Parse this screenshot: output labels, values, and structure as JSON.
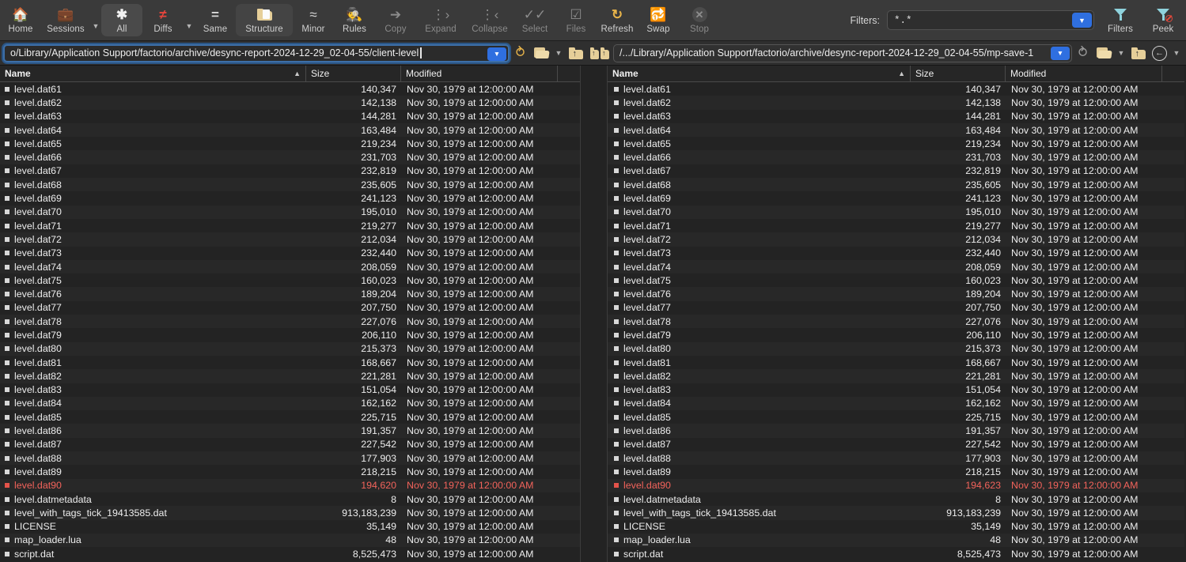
{
  "toolbar": {
    "buttons": [
      {
        "label": "Home",
        "icon": "home-icon",
        "state": "normal"
      },
      {
        "label": "Sessions",
        "icon": "briefcase-icon",
        "state": "normal",
        "caret": true
      },
      {
        "label": "All",
        "icon": "asterisk-icon",
        "state": "active"
      },
      {
        "label": "Diffs",
        "icon": "not-equal-icon",
        "state": "normal",
        "caret": true
      },
      {
        "label": "Same",
        "icon": "equals-icon",
        "state": "normal"
      },
      {
        "label": "Structure",
        "icon": "folder-file-icon",
        "state": "panel",
        "caret": true
      },
      {
        "label": "Minor",
        "icon": "approx-equal-icon",
        "state": "normal"
      },
      {
        "label": "Rules",
        "icon": "detective-icon",
        "state": "normal"
      },
      {
        "label": "Copy",
        "icon": "right-arrow-icon",
        "state": "disabled"
      },
      {
        "label": "Expand",
        "icon": "expand-tree-icon",
        "state": "disabled"
      },
      {
        "label": "Collapse",
        "icon": "collapse-tree-icon",
        "state": "disabled"
      },
      {
        "label": "Select",
        "icon": "double-check-icon",
        "state": "disabled"
      },
      {
        "label": "Files",
        "icon": "checked-file-icon",
        "state": "disabled"
      },
      {
        "label": "Refresh",
        "icon": "refresh-icon",
        "state": "normal"
      },
      {
        "label": "Swap",
        "icon": "swap-icon",
        "state": "normal"
      },
      {
        "label": "Stop",
        "icon": "stop-x-icon",
        "state": "disabled"
      }
    ],
    "filters_label": "Filters:",
    "filters_value": "*.*",
    "filters_button_label": "Filters",
    "peek_button_label": "Peek"
  },
  "pathbar": {
    "left_path": "o/Library/Application Support/factorio/archive/desync-report-2024-12-29_02-04-55/client-level",
    "right_path": "/.../Library/Application Support/factorio/archive/desync-report-2024-12-29_02-04-55/mp-save-1"
  },
  "columns": {
    "name": "Name",
    "size": "Size",
    "modified": "Modified"
  },
  "timestamp": "Nov 30, 1979 at 12:00:00 AM",
  "colors": {
    "diff_red": "#f2635b",
    "accent_blue": "#2f6fe0",
    "folder_yellow": "#e6cf99",
    "refresh_orange": "#e8b44a"
  },
  "left_pane": {
    "rows": [
      {
        "name": "level.dat61",
        "size": "140,347",
        "modified": "Nov 30, 1979 at 12:00:00 AM",
        "diff": false
      },
      {
        "name": "level.dat62",
        "size": "142,138",
        "modified": "Nov 30, 1979 at 12:00:00 AM",
        "diff": false
      },
      {
        "name": "level.dat63",
        "size": "144,281",
        "modified": "Nov 30, 1979 at 12:00:00 AM",
        "diff": false
      },
      {
        "name": "level.dat64",
        "size": "163,484",
        "modified": "Nov 30, 1979 at 12:00:00 AM",
        "diff": false
      },
      {
        "name": "level.dat65",
        "size": "219,234",
        "modified": "Nov 30, 1979 at 12:00:00 AM",
        "diff": false
      },
      {
        "name": "level.dat66",
        "size": "231,703",
        "modified": "Nov 30, 1979 at 12:00:00 AM",
        "diff": false
      },
      {
        "name": "level.dat67",
        "size": "232,819",
        "modified": "Nov 30, 1979 at 12:00:00 AM",
        "diff": false
      },
      {
        "name": "level.dat68",
        "size": "235,605",
        "modified": "Nov 30, 1979 at 12:00:00 AM",
        "diff": false
      },
      {
        "name": "level.dat69",
        "size": "241,123",
        "modified": "Nov 30, 1979 at 12:00:00 AM",
        "diff": false
      },
      {
        "name": "level.dat70",
        "size": "195,010",
        "modified": "Nov 30, 1979 at 12:00:00 AM",
        "diff": false
      },
      {
        "name": "level.dat71",
        "size": "219,277",
        "modified": "Nov 30, 1979 at 12:00:00 AM",
        "diff": false
      },
      {
        "name": "level.dat72",
        "size": "212,034",
        "modified": "Nov 30, 1979 at 12:00:00 AM",
        "diff": false
      },
      {
        "name": "level.dat73",
        "size": "232,440",
        "modified": "Nov 30, 1979 at 12:00:00 AM",
        "diff": false
      },
      {
        "name": "level.dat74",
        "size": "208,059",
        "modified": "Nov 30, 1979 at 12:00:00 AM",
        "diff": false
      },
      {
        "name": "level.dat75",
        "size": "160,023",
        "modified": "Nov 30, 1979 at 12:00:00 AM",
        "diff": false
      },
      {
        "name": "level.dat76",
        "size": "189,204",
        "modified": "Nov 30, 1979 at 12:00:00 AM",
        "diff": false
      },
      {
        "name": "level.dat77",
        "size": "207,750",
        "modified": "Nov 30, 1979 at 12:00:00 AM",
        "diff": false
      },
      {
        "name": "level.dat78",
        "size": "227,076",
        "modified": "Nov 30, 1979 at 12:00:00 AM",
        "diff": false
      },
      {
        "name": "level.dat79",
        "size": "206,110",
        "modified": "Nov 30, 1979 at 12:00:00 AM",
        "diff": false
      },
      {
        "name": "level.dat80",
        "size": "215,373",
        "modified": "Nov 30, 1979 at 12:00:00 AM",
        "diff": false
      },
      {
        "name": "level.dat81",
        "size": "168,667",
        "modified": "Nov 30, 1979 at 12:00:00 AM",
        "diff": false
      },
      {
        "name": "level.dat82",
        "size": "221,281",
        "modified": "Nov 30, 1979 at 12:00:00 AM",
        "diff": false
      },
      {
        "name": "level.dat83",
        "size": "151,054",
        "modified": "Nov 30, 1979 at 12:00:00 AM",
        "diff": false
      },
      {
        "name": "level.dat84",
        "size": "162,162",
        "modified": "Nov 30, 1979 at 12:00:00 AM",
        "diff": false
      },
      {
        "name": "level.dat85",
        "size": "225,715",
        "modified": "Nov 30, 1979 at 12:00:00 AM",
        "diff": false
      },
      {
        "name": "level.dat86",
        "size": "191,357",
        "modified": "Nov 30, 1979 at 12:00:00 AM",
        "diff": false
      },
      {
        "name": "level.dat87",
        "size": "227,542",
        "modified": "Nov 30, 1979 at 12:00:00 AM",
        "diff": false
      },
      {
        "name": "level.dat88",
        "size": "177,903",
        "modified": "Nov 30, 1979 at 12:00:00 AM",
        "diff": false
      },
      {
        "name": "level.dat89",
        "size": "218,215",
        "modified": "Nov 30, 1979 at 12:00:00 AM",
        "diff": false
      },
      {
        "name": "level.dat90",
        "size": "194,620",
        "modified": "Nov 30, 1979 at 12:00:00 AM",
        "diff": true
      },
      {
        "name": "level.datmetadata",
        "size": "8",
        "modified": "Nov 30, 1979 at 12:00:00 AM",
        "diff": false
      },
      {
        "name": "level_with_tags_tick_19413585.dat",
        "size": "913,183,239",
        "modified": "Nov 30, 1979 at 12:00:00 AM",
        "diff": false
      },
      {
        "name": "LICENSE",
        "size": "35,149",
        "modified": "Nov 30, 1979 at 12:00:00 AM",
        "diff": false
      },
      {
        "name": "map_loader.lua",
        "size": "48",
        "modified": "Nov 30, 1979 at 12:00:00 AM",
        "diff": false
      },
      {
        "name": "script.dat",
        "size": "8,525,473",
        "modified": "Nov 30, 1979 at 12:00:00 AM",
        "diff": false
      }
    ]
  },
  "right_pane": {
    "rows": [
      {
        "name": "level.dat61",
        "size": "140,347",
        "modified": "Nov 30, 1979 at 12:00:00 AM",
        "diff": false
      },
      {
        "name": "level.dat62",
        "size": "142,138",
        "modified": "Nov 30, 1979 at 12:00:00 AM",
        "diff": false
      },
      {
        "name": "level.dat63",
        "size": "144,281",
        "modified": "Nov 30, 1979 at 12:00:00 AM",
        "diff": false
      },
      {
        "name": "level.dat64",
        "size": "163,484",
        "modified": "Nov 30, 1979 at 12:00:00 AM",
        "diff": false
      },
      {
        "name": "level.dat65",
        "size": "219,234",
        "modified": "Nov 30, 1979 at 12:00:00 AM",
        "diff": false
      },
      {
        "name": "level.dat66",
        "size": "231,703",
        "modified": "Nov 30, 1979 at 12:00:00 AM",
        "diff": false
      },
      {
        "name": "level.dat67",
        "size": "232,819",
        "modified": "Nov 30, 1979 at 12:00:00 AM",
        "diff": false
      },
      {
        "name": "level.dat68",
        "size": "235,605",
        "modified": "Nov 30, 1979 at 12:00:00 AM",
        "diff": false
      },
      {
        "name": "level.dat69",
        "size": "241,123",
        "modified": "Nov 30, 1979 at 12:00:00 AM",
        "diff": false
      },
      {
        "name": "level.dat70",
        "size": "195,010",
        "modified": "Nov 30, 1979 at 12:00:00 AM",
        "diff": false
      },
      {
        "name": "level.dat71",
        "size": "219,277",
        "modified": "Nov 30, 1979 at 12:00:00 AM",
        "diff": false
      },
      {
        "name": "level.dat72",
        "size": "212,034",
        "modified": "Nov 30, 1979 at 12:00:00 AM",
        "diff": false
      },
      {
        "name": "level.dat73",
        "size": "232,440",
        "modified": "Nov 30, 1979 at 12:00:00 AM",
        "diff": false
      },
      {
        "name": "level.dat74",
        "size": "208,059",
        "modified": "Nov 30, 1979 at 12:00:00 AM",
        "diff": false
      },
      {
        "name": "level.dat75",
        "size": "160,023",
        "modified": "Nov 30, 1979 at 12:00:00 AM",
        "diff": false
      },
      {
        "name": "level.dat76",
        "size": "189,204",
        "modified": "Nov 30, 1979 at 12:00:00 AM",
        "diff": false
      },
      {
        "name": "level.dat77",
        "size": "207,750",
        "modified": "Nov 30, 1979 at 12:00:00 AM",
        "diff": false
      },
      {
        "name": "level.dat78",
        "size": "227,076",
        "modified": "Nov 30, 1979 at 12:00:00 AM",
        "diff": false
      },
      {
        "name": "level.dat79",
        "size": "206,110",
        "modified": "Nov 30, 1979 at 12:00:00 AM",
        "diff": false
      },
      {
        "name": "level.dat80",
        "size": "215,373",
        "modified": "Nov 30, 1979 at 12:00:00 AM",
        "diff": false
      },
      {
        "name": "level.dat81",
        "size": "168,667",
        "modified": "Nov 30, 1979 at 12:00:00 AM",
        "diff": false
      },
      {
        "name": "level.dat82",
        "size": "221,281",
        "modified": "Nov 30, 1979 at 12:00:00 AM",
        "diff": false
      },
      {
        "name": "level.dat83",
        "size": "151,054",
        "modified": "Nov 30, 1979 at 12:00:00 AM",
        "diff": false
      },
      {
        "name": "level.dat84",
        "size": "162,162",
        "modified": "Nov 30, 1979 at 12:00:00 AM",
        "diff": false
      },
      {
        "name": "level.dat85",
        "size": "225,715",
        "modified": "Nov 30, 1979 at 12:00:00 AM",
        "diff": false
      },
      {
        "name": "level.dat86",
        "size": "191,357",
        "modified": "Nov 30, 1979 at 12:00:00 AM",
        "diff": false
      },
      {
        "name": "level.dat87",
        "size": "227,542",
        "modified": "Nov 30, 1979 at 12:00:00 AM",
        "diff": false
      },
      {
        "name": "level.dat88",
        "size": "177,903",
        "modified": "Nov 30, 1979 at 12:00:00 AM",
        "diff": false
      },
      {
        "name": "level.dat89",
        "size": "218,215",
        "modified": "Nov 30, 1979 at 12:00:00 AM",
        "diff": false
      },
      {
        "name": "level.dat90",
        "size": "194,623",
        "modified": "Nov 30, 1979 at 12:00:00 AM",
        "diff": true
      },
      {
        "name": "level.datmetadata",
        "size": "8",
        "modified": "Nov 30, 1979 at 12:00:00 AM",
        "diff": false
      },
      {
        "name": "level_with_tags_tick_19413585.dat",
        "size": "913,183,239",
        "modified": "Nov 30, 1979 at 12:00:00 AM",
        "diff": false
      },
      {
        "name": "LICENSE",
        "size": "35,149",
        "modified": "Nov 30, 1979 at 12:00:00 AM",
        "diff": false
      },
      {
        "name": "map_loader.lua",
        "size": "48",
        "modified": "Nov 30, 1979 at 12:00:00 AM",
        "diff": false
      },
      {
        "name": "script.dat",
        "size": "8,525,473",
        "modified": "Nov 30, 1979 at 12:00:00 AM",
        "diff": false
      }
    ]
  }
}
